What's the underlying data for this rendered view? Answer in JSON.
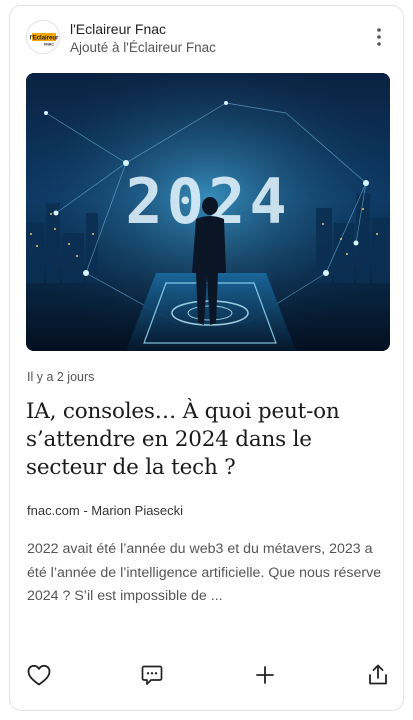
{
  "source": {
    "name": "l'Eclaireur Fnac",
    "subtitle": "Ajouté à l'Éclaireur Fnac",
    "logo_text": "l'Eclaireur",
    "logo_subtext": "FNAC",
    "logo_color": "#f5a800"
  },
  "menu": {
    "icon": "more-vertical-icon"
  },
  "hero": {
    "overlay_text": "2024"
  },
  "article": {
    "timestamp": "Il y a 2 jours",
    "title": "IA, consoles… À quoi peut-on s’attendre en 2024 dans le secteur de la tech ?",
    "byline": "fnac.com - Marion Piasecki",
    "excerpt": "2022 avait été l’année du web3 et du métavers, 2023 a été l’année de l’intelligence artificielle. Que nous réserve 2024 ? S’il est impossible de ..."
  },
  "actions": [
    {
      "icon": "heart-icon"
    },
    {
      "icon": "comment-icon"
    },
    {
      "icon": "plus-icon"
    },
    {
      "icon": "share-icon"
    }
  ]
}
